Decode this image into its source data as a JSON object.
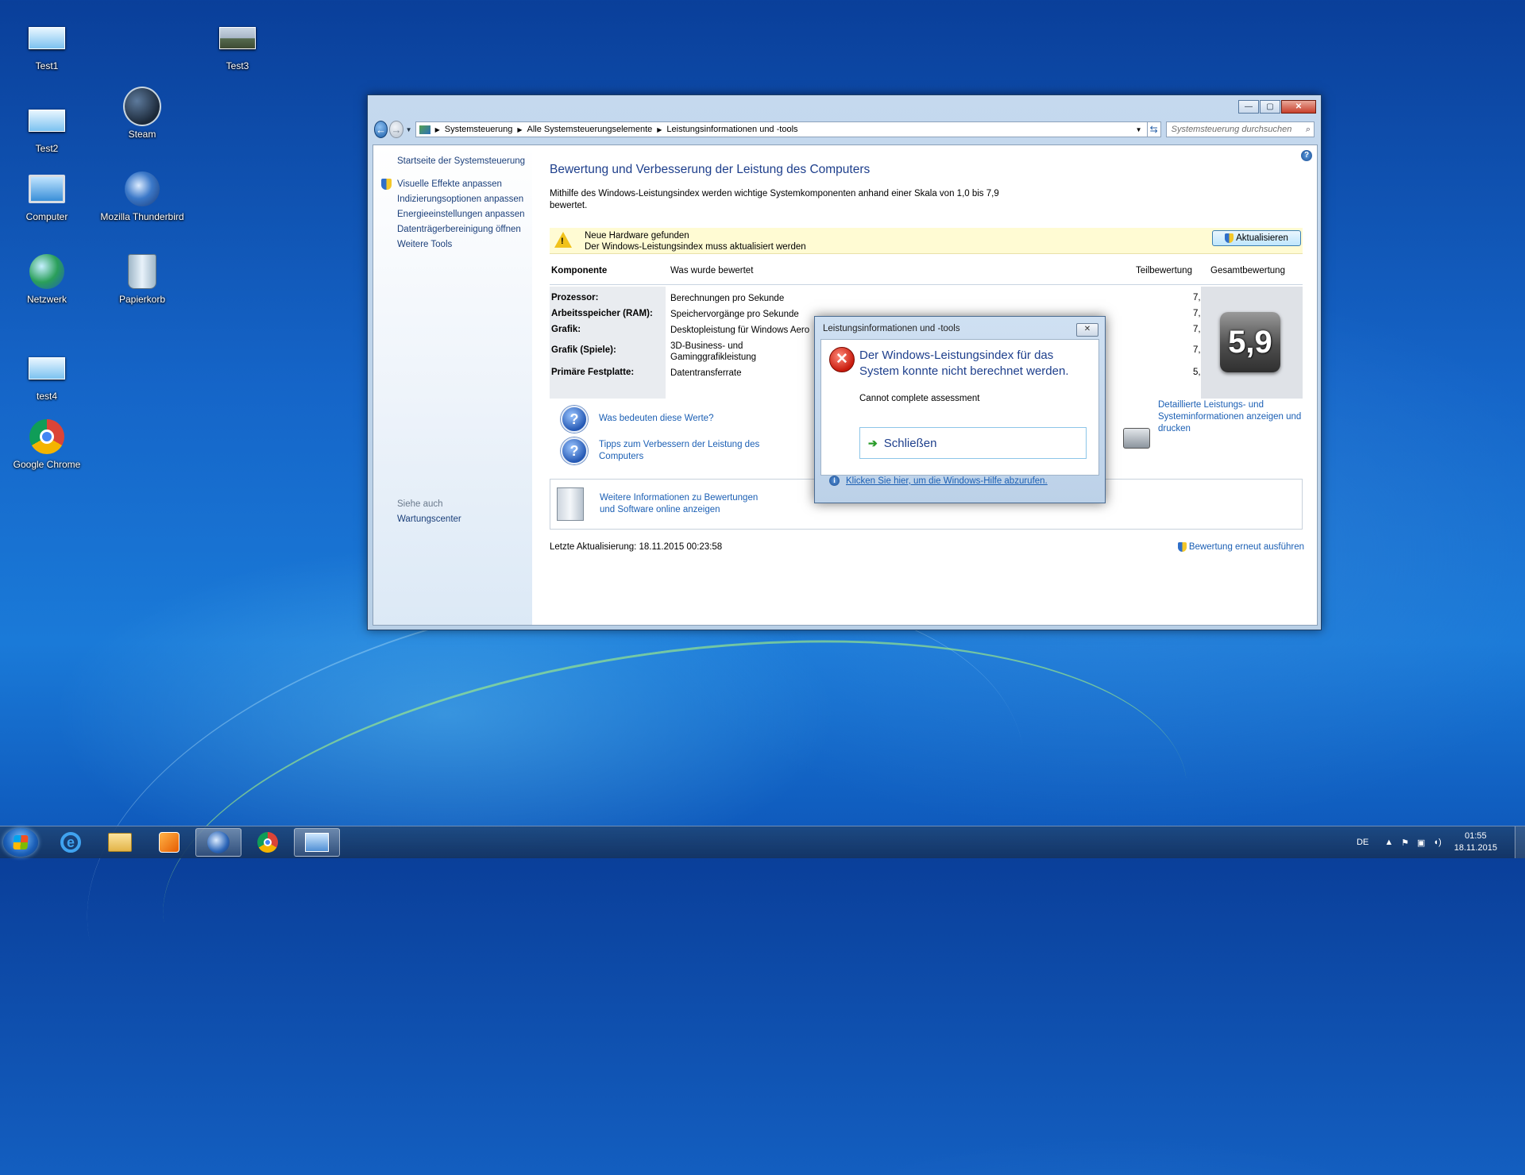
{
  "desktop": {
    "icons": [
      {
        "label": "Test1"
      },
      {
        "label": "Test3"
      },
      {
        "label": "Test2"
      },
      {
        "label": "Steam"
      },
      {
        "label": "Computer"
      },
      {
        "label": "Mozilla Thunderbird"
      },
      {
        "label": "Netzwerk"
      },
      {
        "label": "Papierkorb"
      },
      {
        "label": "test4"
      },
      {
        "label": "Google Chrome"
      }
    ]
  },
  "window": {
    "caption_buttons": {
      "minimize": "—",
      "maximize": "▢",
      "close": "✕"
    },
    "breadcrumb": [
      "Systemsteuerung",
      "Alle Systemsteuerungselemente",
      "Leistungsinformationen und -tools"
    ],
    "search_placeholder": "Systemsteuerung durchsuchen",
    "sidebar": {
      "home": "Startseite der Systemsteuerung",
      "links": [
        "Visuelle Effekte anpassen",
        "Indizierungsoptionen anpassen",
        "Energieeinstellungen anpassen",
        "Datenträgerbereinigung öffnen",
        "Weitere Tools"
      ],
      "see_also_title": "Siehe auch",
      "see_also": [
        "Wartungscenter"
      ]
    },
    "main": {
      "title": "Bewertung und Verbesserung der Leistung des Computers",
      "description": "Mithilfe des Windows-Leistungsindex werden wichtige Systemkomponenten anhand einer Skala von 1,0 bis 7,9 bewertet.",
      "notice": {
        "line1": "Neue Hardware gefunden",
        "line2": "Der Windows-Leistungsindex muss aktualisiert werden",
        "button": "Aktualisieren"
      },
      "table": {
        "headers": {
          "component": "Komponente",
          "rated": "Was wurde bewertet",
          "subscore": "Teilbewertung",
          "basescore": "Gesamtbewertung"
        },
        "rows": [
          {
            "component": "Prozessor:",
            "rated": "Berechnungen pro Sekunde",
            "score": "7,8"
          },
          {
            "component": "Arbeitsspeicher (RAM):",
            "rated": "Speichervorgänge pro Sekunde",
            "score": "7,9"
          },
          {
            "component": "Grafik:",
            "rated": "Desktopleistung für Windows Aero",
            "score": "7,8"
          },
          {
            "component": "Grafik (Spiele):",
            "rated": "3D-Business- und Gaminggrafikleistung",
            "score": "7,8"
          },
          {
            "component": "Primäre Festplatte:",
            "rated": "Datentransferrate",
            "score": "5,9"
          }
        ],
        "base_score": "5,9"
      },
      "links": {
        "what_values": "Was bedeuten diese Werte?",
        "tips": "Tipps zum Verbessern der Leistung des Computers",
        "details": "Detaillierte Leistungs- und Systeminformationen anzeigen und drucken",
        "more_info": "Weitere Informationen zu Bewertungen und Software online anzeigen"
      },
      "last_update": "Letzte Aktualisierung: 18.11.2015 00:23:58",
      "rerun": "Bewertung erneut ausführen"
    }
  },
  "dialog": {
    "title": "Leistungsinformationen und -tools",
    "heading": "Der Windows-Leistungsindex für das System konnte nicht berechnet werden.",
    "message": "Cannot complete assessment",
    "close_button": "Schließen",
    "help_link": "Klicken Sie hier, um die Windows-Hilfe abzurufen."
  },
  "taskbar": {
    "language": "DE",
    "time": "01:55",
    "date": "18.11.2015"
  }
}
